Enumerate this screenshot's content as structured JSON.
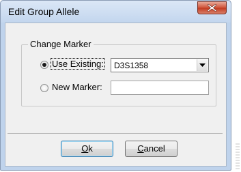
{
  "window": {
    "title": "Edit Group Allele"
  },
  "group": {
    "label": "Change Marker"
  },
  "options": {
    "use_existing_label": "Use Existing:",
    "use_existing_selected": true,
    "new_marker_label": "New Marker:",
    "new_marker_selected": false
  },
  "marker_select": {
    "value": "D3S1358"
  },
  "new_marker_input": {
    "value": ""
  },
  "buttons": {
    "ok_mnemonic": "O",
    "ok_rest": "k",
    "cancel_mnemonic": "C",
    "cancel_rest": "ancel"
  },
  "icons": {
    "close": "close-icon",
    "dropdown": "chevron-down-icon"
  },
  "colors": {
    "titlebar": "#c3d6ee",
    "close_button": "#c23a1f",
    "client_bg": "#f0f0f0"
  }
}
